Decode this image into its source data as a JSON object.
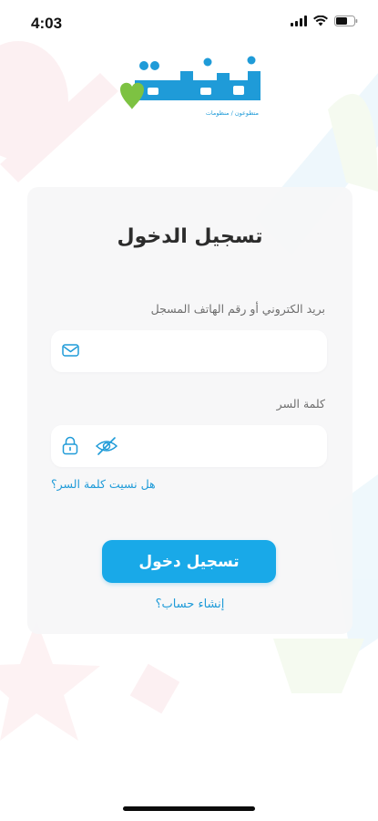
{
  "status_bar": {
    "time": "4:03"
  },
  "logo": {
    "tagline": "متطوعون / منظومات"
  },
  "login": {
    "title": "تسجيل الدخول",
    "email_label": "بريد الكتروني أو رقم الهاتف المسجل",
    "email_value": "",
    "password_label": "كلمة السر",
    "password_value": "",
    "forgot_password": "هل نسيت كلمة السر؟",
    "submit_label": "تسجيل دخول",
    "create_account": "إنشاء حساب؟"
  },
  "colors": {
    "accent": "#19A9E8",
    "link": "#1F9BD8",
    "logo_green": "#7DC242",
    "card_bg": "#F6F6F8"
  },
  "icons": {
    "email": "mail-icon",
    "lock": "lock-icon",
    "visibility": "eye-off-icon"
  }
}
